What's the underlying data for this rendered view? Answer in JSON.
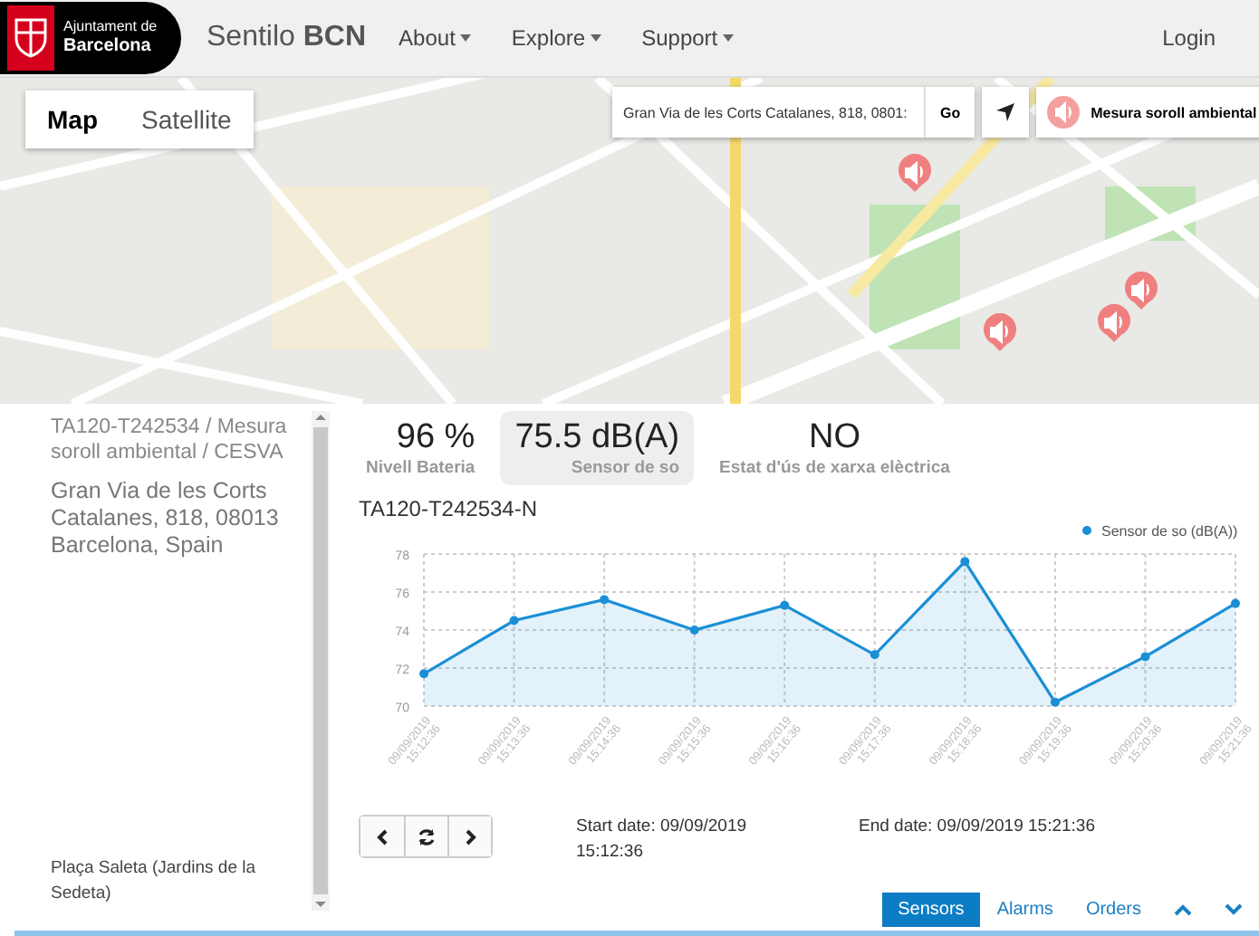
{
  "header": {
    "logo_lines": [
      "Ajuntament de",
      "Barcelona"
    ],
    "brand": "Sentilo **BCN**",
    "nav": [
      {
        "label": "About"
      },
      {
        "label": "Explore"
      },
      {
        "label": "Support"
      }
    ],
    "login": "Login"
  },
  "map": {
    "tabs": [
      {
        "label": "Map",
        "selected": true
      },
      {
        "label": "Satellite",
        "selected": false
      }
    ],
    "search": {
      "value": "Gran Via de les Corts Catalanes, 818, 0801:"
    },
    "go": "Go",
    "layer": "Mesura soroll ambiental"
  },
  "sidebar": {
    "title": "TA120-T242534 / Mesura soroll ambiental / CESVA",
    "address": "Gran Via de les Corts Catalanes, 818, 08013 Barcelona, Spain",
    "place": "Plaça Saleta (Jardins de la Sedeta)"
  },
  "readings": [
    {
      "value": "96 %",
      "label": "Nivell Bateria",
      "selected": false
    },
    {
      "value": "75.5 dB(A)",
      "label": "Sensor de so",
      "selected": true
    },
    {
      "value": "NO",
      "label": "Estat d'ús de xarxa elèctrica",
      "selected": false
    }
  ],
  "chart_title": "TA120-T242534-N",
  "chart_data": {
    "type": "area",
    "categories": [
      "09/09/2019 15:12:36",
      "09/09/2019 15:13:36",
      "09/09/2019 15:14:36",
      "09/09/2019 15:15:36",
      "09/09/2019 15:16:36",
      "09/09/2019 15:17:36",
      "09/09/2019 15:18:36",
      "09/09/2019 15:19:36",
      "09/09/2019 15:20:36",
      "09/09/2019 15:21:36"
    ],
    "series": [
      {
        "name": "Sensor de so (dB(A))",
        "color": "#1a8fd6",
        "values": [
          71.7,
          74.5,
          75.6,
          74.0,
          75.3,
          72.7,
          77.6,
          70.2,
          72.6,
          75.4
        ]
      }
    ],
    "ylim": [
      70,
      78
    ],
    "grid": true,
    "yticks": [
      70,
      72,
      74,
      76,
      78
    ]
  },
  "dates": {
    "start": "Start date: 09/09/2019 15:12:36",
    "end": "End date: 09/09/2019 15:21:36"
  },
  "bottom_tabs": [
    {
      "label": "Sensors",
      "selected": true
    },
    {
      "label": "Alarms",
      "selected": false
    },
    {
      "label": "Orders",
      "selected": false
    }
  ]
}
